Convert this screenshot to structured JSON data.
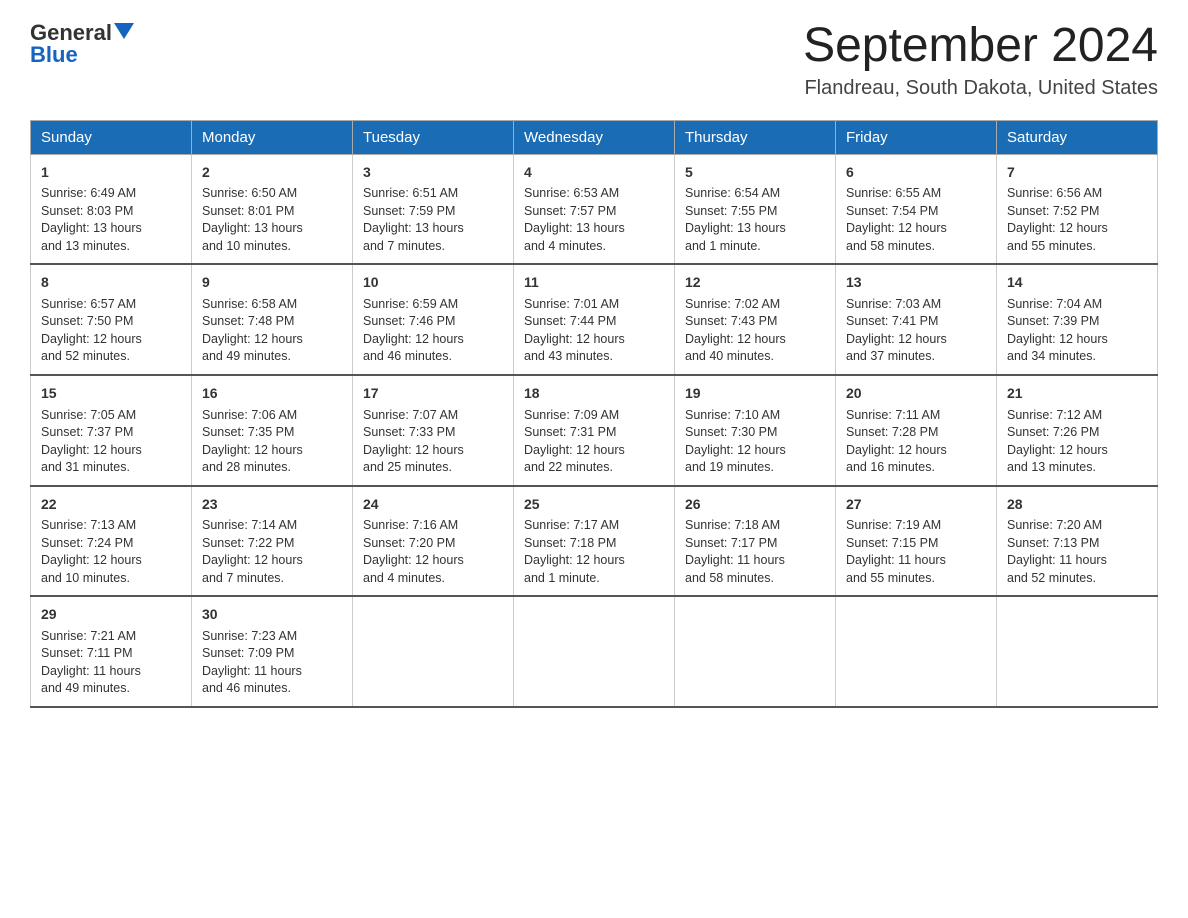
{
  "header": {
    "logo": {
      "general": "General",
      "blue": "Blue"
    },
    "title": "September 2024",
    "subtitle": "Flandreau, South Dakota, United States"
  },
  "calendar": {
    "days_of_week": [
      "Sunday",
      "Monday",
      "Tuesday",
      "Wednesday",
      "Thursday",
      "Friday",
      "Saturday"
    ],
    "weeks": [
      [
        {
          "day": "1",
          "sunrise": "6:49 AM",
          "sunset": "8:03 PM",
          "daylight": "13 hours and 13 minutes."
        },
        {
          "day": "2",
          "sunrise": "6:50 AM",
          "sunset": "8:01 PM",
          "daylight": "13 hours and 10 minutes."
        },
        {
          "day": "3",
          "sunrise": "6:51 AM",
          "sunset": "7:59 PM",
          "daylight": "13 hours and 7 minutes."
        },
        {
          "day": "4",
          "sunrise": "6:53 AM",
          "sunset": "7:57 PM",
          "daylight": "13 hours and 4 minutes."
        },
        {
          "day": "5",
          "sunrise": "6:54 AM",
          "sunset": "7:55 PM",
          "daylight": "13 hours and 1 minute."
        },
        {
          "day": "6",
          "sunrise": "6:55 AM",
          "sunset": "7:54 PM",
          "daylight": "12 hours and 58 minutes."
        },
        {
          "day": "7",
          "sunrise": "6:56 AM",
          "sunset": "7:52 PM",
          "daylight": "12 hours and 55 minutes."
        }
      ],
      [
        {
          "day": "8",
          "sunrise": "6:57 AM",
          "sunset": "7:50 PM",
          "daylight": "12 hours and 52 minutes."
        },
        {
          "day": "9",
          "sunrise": "6:58 AM",
          "sunset": "7:48 PM",
          "daylight": "12 hours and 49 minutes."
        },
        {
          "day": "10",
          "sunrise": "6:59 AM",
          "sunset": "7:46 PM",
          "daylight": "12 hours and 46 minutes."
        },
        {
          "day": "11",
          "sunrise": "7:01 AM",
          "sunset": "7:44 PM",
          "daylight": "12 hours and 43 minutes."
        },
        {
          "day": "12",
          "sunrise": "7:02 AM",
          "sunset": "7:43 PM",
          "daylight": "12 hours and 40 minutes."
        },
        {
          "day": "13",
          "sunrise": "7:03 AM",
          "sunset": "7:41 PM",
          "daylight": "12 hours and 37 minutes."
        },
        {
          "day": "14",
          "sunrise": "7:04 AM",
          "sunset": "7:39 PM",
          "daylight": "12 hours and 34 minutes."
        }
      ],
      [
        {
          "day": "15",
          "sunrise": "7:05 AM",
          "sunset": "7:37 PM",
          "daylight": "12 hours and 31 minutes."
        },
        {
          "day": "16",
          "sunrise": "7:06 AM",
          "sunset": "7:35 PM",
          "daylight": "12 hours and 28 minutes."
        },
        {
          "day": "17",
          "sunrise": "7:07 AM",
          "sunset": "7:33 PM",
          "daylight": "12 hours and 25 minutes."
        },
        {
          "day": "18",
          "sunrise": "7:09 AM",
          "sunset": "7:31 PM",
          "daylight": "12 hours and 22 minutes."
        },
        {
          "day": "19",
          "sunrise": "7:10 AM",
          "sunset": "7:30 PM",
          "daylight": "12 hours and 19 minutes."
        },
        {
          "day": "20",
          "sunrise": "7:11 AM",
          "sunset": "7:28 PM",
          "daylight": "12 hours and 16 minutes."
        },
        {
          "day": "21",
          "sunrise": "7:12 AM",
          "sunset": "7:26 PM",
          "daylight": "12 hours and 13 minutes."
        }
      ],
      [
        {
          "day": "22",
          "sunrise": "7:13 AM",
          "sunset": "7:24 PM",
          "daylight": "12 hours and 10 minutes."
        },
        {
          "day": "23",
          "sunrise": "7:14 AM",
          "sunset": "7:22 PM",
          "daylight": "12 hours and 7 minutes."
        },
        {
          "day": "24",
          "sunrise": "7:16 AM",
          "sunset": "7:20 PM",
          "daylight": "12 hours and 4 minutes."
        },
        {
          "day": "25",
          "sunrise": "7:17 AM",
          "sunset": "7:18 PM",
          "daylight": "12 hours and 1 minute."
        },
        {
          "day": "26",
          "sunrise": "7:18 AM",
          "sunset": "7:17 PM",
          "daylight": "11 hours and 58 minutes."
        },
        {
          "day": "27",
          "sunrise": "7:19 AM",
          "sunset": "7:15 PM",
          "daylight": "11 hours and 55 minutes."
        },
        {
          "day": "28",
          "sunrise": "7:20 AM",
          "sunset": "7:13 PM",
          "daylight": "11 hours and 52 minutes."
        }
      ],
      [
        {
          "day": "29",
          "sunrise": "7:21 AM",
          "sunset": "7:11 PM",
          "daylight": "11 hours and 49 minutes."
        },
        {
          "day": "30",
          "sunrise": "7:23 AM",
          "sunset": "7:09 PM",
          "daylight": "11 hours and 46 minutes."
        },
        null,
        null,
        null,
        null,
        null
      ]
    ],
    "labels": {
      "sunrise": "Sunrise:",
      "sunset": "Sunset:",
      "daylight": "Daylight:"
    }
  }
}
